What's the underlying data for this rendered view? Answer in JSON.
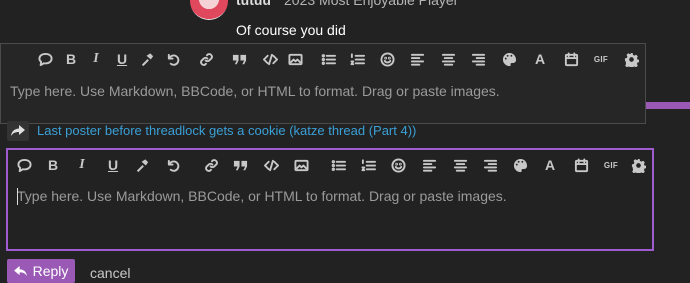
{
  "post": {
    "username": "tutuu",
    "flair": "2023 Most Enjoyable Player",
    "text": "Of course you did"
  },
  "editor": {
    "placeholder": "Type here. Use Markdown, BBCode, or HTML to format. Drag or paste images.",
    "toolbar": {
      "bold": "B",
      "italic": "I",
      "underline": "U",
      "font": "A",
      "gif": "GIF"
    }
  },
  "topic_link": "Last poster before threadlock gets a cookie (katze thread (Part 4))",
  "actions": {
    "reply": "Reply",
    "cancel": "cancel"
  },
  "colors": {
    "accent": "#9b59b6",
    "link": "#3aa0d8",
    "background": "#222222"
  }
}
